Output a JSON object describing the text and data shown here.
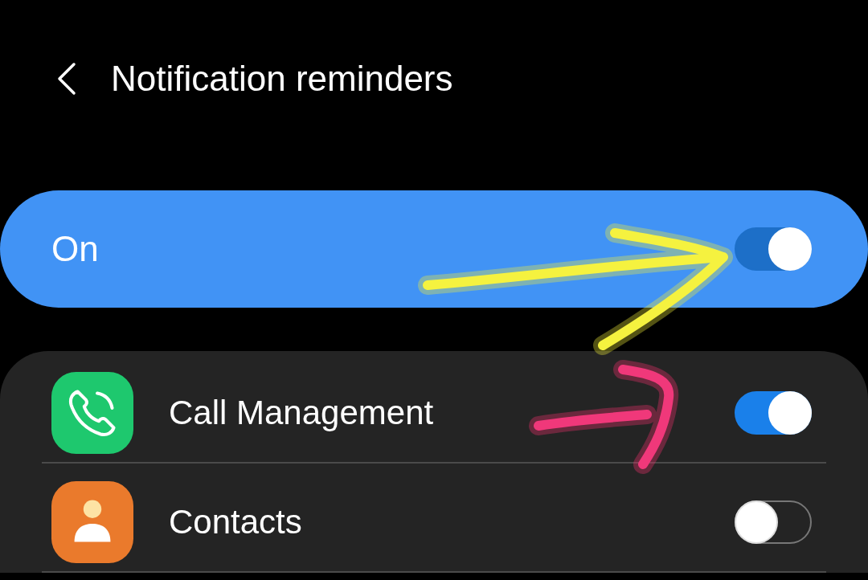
{
  "header": {
    "title": "Notification reminders"
  },
  "master": {
    "label": "On",
    "on": true
  },
  "apps": [
    {
      "name": "Call Management",
      "kind": "phone",
      "on": true
    },
    {
      "name": "Contacts",
      "kind": "person",
      "on": false
    }
  ]
}
